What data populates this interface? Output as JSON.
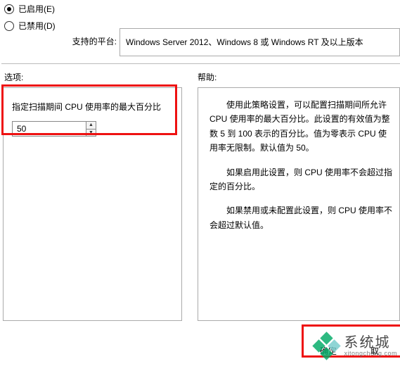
{
  "radios": {
    "enabled": {
      "label": "已启用(E)",
      "selected": true
    },
    "disabled": {
      "label": "已禁用(D)",
      "selected": false
    }
  },
  "supported": {
    "label": "支持的平台:",
    "value": "Windows Server 2012、Windows 8 或 Windows RT 及以上版本"
  },
  "sections": {
    "options": "选项:",
    "help": "帮助:"
  },
  "option": {
    "label": "指定扫描期间 CPU 使用率的最大百分比",
    "value": "50"
  },
  "help": {
    "p1": "使用此策略设置，可以配置扫描期间所允许 CPU 使用率的最大百分比。此设置的有效值为整数 5 到 100 表示的百分比。值为零表示 CPU 使用率无限制。默认值为 50。",
    "p2": "如果启用此设置，则 CPU 使用率不会超过指定的百分比。",
    "p3": "如果禁用或未配置此设置，则 CPU 使用率不会超过默认值。"
  },
  "buttons": {
    "ok": "确定",
    "cancel": "取"
  },
  "watermark": {
    "cn": "系统城",
    "en": "xitongcheng.com"
  }
}
